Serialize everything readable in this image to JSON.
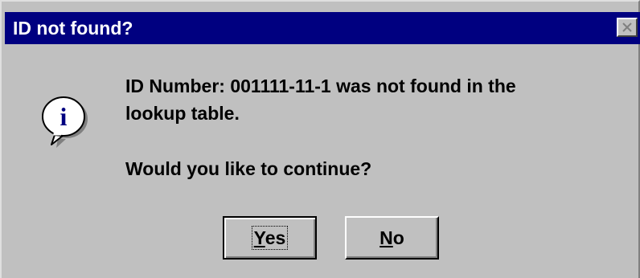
{
  "window": {
    "title": "ID not found?",
    "close_glyph": "✕",
    "colors": {
      "titlebar": "#000080",
      "face": "#c0c0c0",
      "text": "#000000"
    }
  },
  "icon": {
    "name": "information-icon",
    "glyph": "i"
  },
  "message": {
    "line1": "ID Number: 001111-11-1 was not found in the",
    "line2": "lookup table.",
    "question": "Would you like to continue?"
  },
  "buttons": {
    "yes": {
      "mnemonic": "Y",
      "rest": "es",
      "default": true
    },
    "no": {
      "mnemonic": "N",
      "rest": "o"
    }
  }
}
